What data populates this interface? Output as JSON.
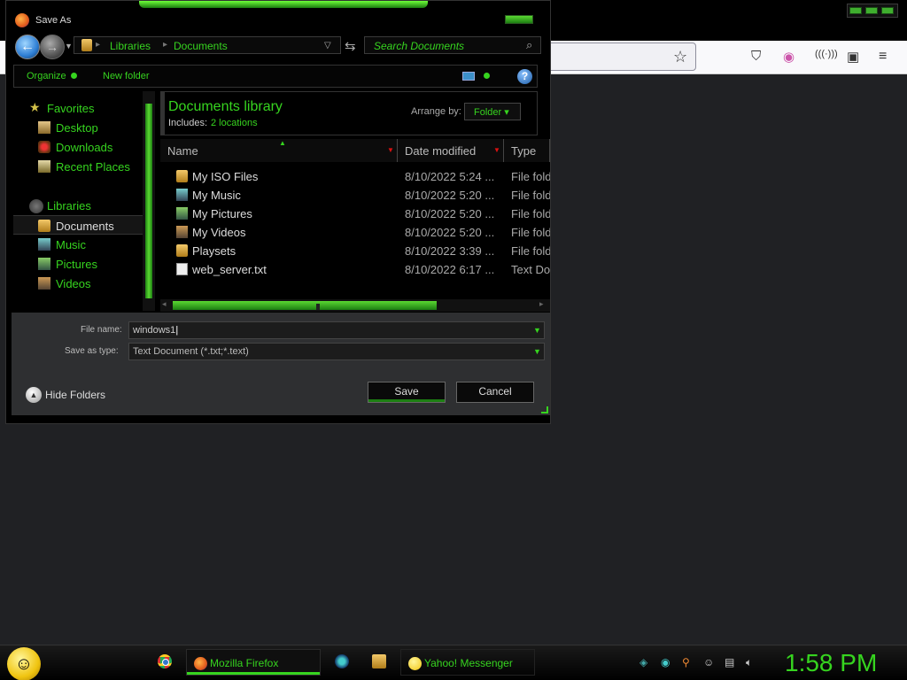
{
  "dialog": {
    "title": "Save As",
    "address": {
      "crumbs": [
        "Libraries",
        "Documents"
      ]
    },
    "search_placeholder": "Search Documents",
    "toolbar": {
      "organize": "Organize",
      "new_folder": "New folder",
      "help": "?"
    },
    "nav": {
      "favorites_header": "Favorites",
      "favorites": [
        "Desktop",
        "Downloads",
        "Recent Places"
      ],
      "libraries_header": "Libraries",
      "libraries": [
        "Documents",
        "Music",
        "Pictures",
        "Videos"
      ],
      "selected": "Documents"
    },
    "library": {
      "title": "Documents library",
      "includes_label": "Includes:",
      "includes_link": "2 locations",
      "arrange_label": "Arrange by:",
      "arrange_value": "Folder"
    },
    "columns": [
      "Name",
      "Date modified",
      "Type"
    ],
    "files": [
      {
        "name": "My ISO Files",
        "date": "8/10/2022 5:24 ...",
        "type": "File folder",
        "icon": "folder-icon"
      },
      {
        "name": "My Music",
        "date": "8/10/2022 5:20 ...",
        "type": "File folder",
        "icon": "music-folder-icon"
      },
      {
        "name": "My Pictures",
        "date": "8/10/2022 5:20 ...",
        "type": "File folder",
        "icon": "pictures-folder-icon"
      },
      {
        "name": "My Videos",
        "date": "8/10/2022 5:20 ...",
        "type": "File folder",
        "icon": "videos-folder-icon"
      },
      {
        "name": "Playsets",
        "date": "8/10/2022 3:39 ...",
        "type": "File folder",
        "icon": "folder-icon"
      },
      {
        "name": "web_server.txt",
        "date": "8/10/2022 6:17 ...",
        "type": "Text Document",
        "icon": "text-file-icon"
      }
    ],
    "filename_label": "File name:",
    "filename_value": "windows1",
    "savetype_label": "Save as type:",
    "savetype_value": "Text Document (*.txt;*.text)",
    "hide_folders": "Hide Folders",
    "save": "Save",
    "cancel": "Cancel"
  },
  "taskbar": {
    "tasks": [
      "Mozilla Firefox",
      "Yahoo! Messenger"
    ],
    "clock": "1:58 PM"
  },
  "colors": {
    "accent": "#36d41f",
    "background": "#000000"
  }
}
